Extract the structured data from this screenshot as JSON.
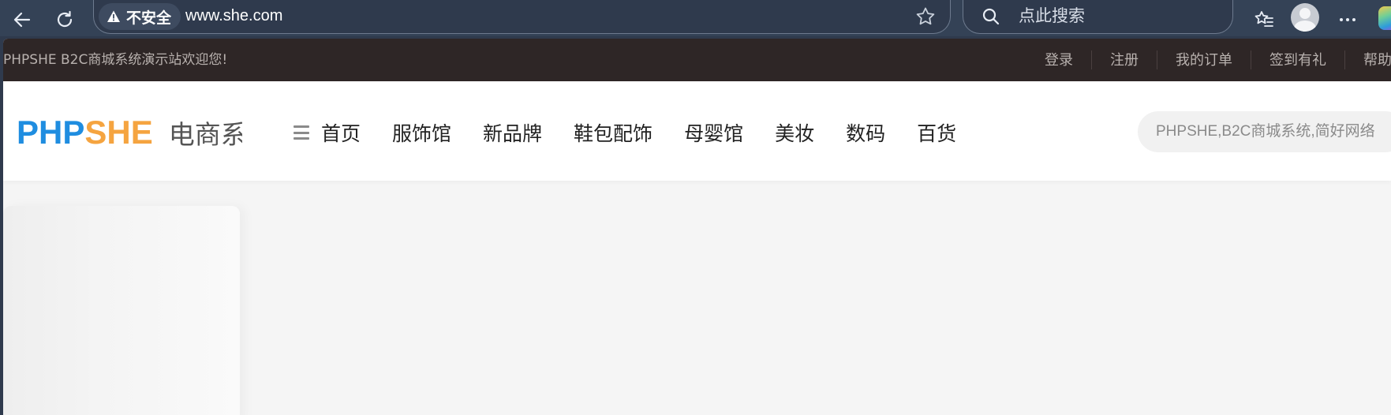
{
  "browser": {
    "security_label": "不安全",
    "url": "www.she.com",
    "search_placeholder": "点此搜索"
  },
  "topbar": {
    "welcome": "PHPSHE B2C商城系统演示站欢迎您!",
    "links": [
      "登录",
      "注册",
      "我的订单",
      "签到有礼",
      "帮助中心"
    ]
  },
  "header": {
    "logo_php": "PHP",
    "logo_she": "SHE",
    "logo_sub": "电商系统",
    "nav": [
      "首页",
      "服饰馆",
      "新品牌",
      "鞋包配饰",
      "母婴馆",
      "美妆",
      "数码",
      "百货"
    ],
    "search_placeholder": "PHPSHE,B2C商城系统,简好网络"
  },
  "colors": {
    "brand_blue": "#1f8de0",
    "brand_orange": "#f5a440",
    "topbar_bg": "#2e2626",
    "chrome_bg": "#344256"
  }
}
